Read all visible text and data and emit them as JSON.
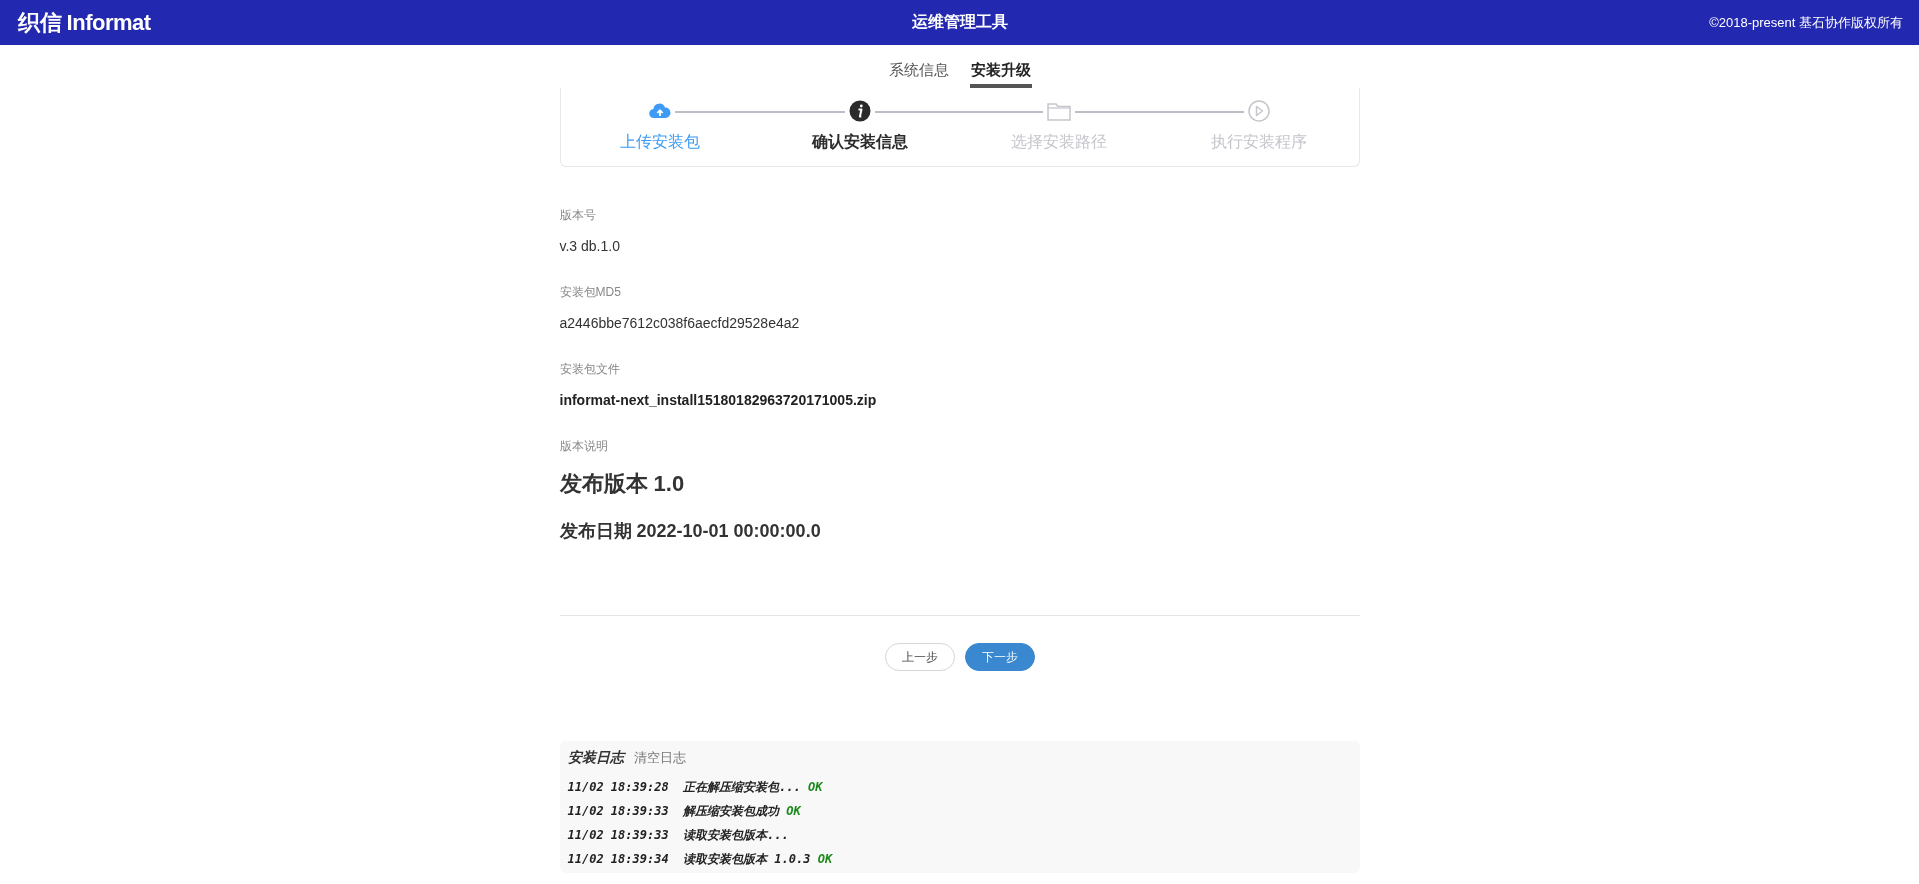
{
  "header": {
    "logo": "织信 Informat",
    "title": "运维管理工具",
    "copyright": "©2018-present 基石协作版权所有"
  },
  "tabs": [
    {
      "label": "系统信息",
      "selected": false
    },
    {
      "label": "安装升级",
      "selected": true
    }
  ],
  "steps": [
    {
      "label": "上传安装包",
      "completed": true,
      "selected": false
    },
    {
      "label": "确认安装信息",
      "completed": false,
      "selected": true
    },
    {
      "label": "选择安装路径",
      "completed": false,
      "selected": false
    },
    {
      "label": "执行安装程序",
      "completed": false,
      "selected": false
    }
  ],
  "fields": [
    {
      "label": "版本号",
      "value": "v.3 db.1.0",
      "kind": "plain"
    },
    {
      "label": "安装包MD5",
      "value": "a2446bbe7612c038f6aecfd29528e4a2",
      "kind": "plain"
    },
    {
      "label": "安装包文件",
      "value": "informat-next_install15180182963720171005.zip",
      "kind": "bold"
    },
    {
      "label": "版本说明",
      "kind": "notes",
      "heading": "发布版本 1.0",
      "subheading": "发布日期 2022-10-01 00:00:00.0"
    }
  ],
  "buttons": [
    {
      "label": "上一步",
      "kind": "secondary"
    },
    {
      "label": "下一步",
      "kind": "primary"
    }
  ],
  "log": {
    "title": "安装日志",
    "clear": "清空日志",
    "entries": [
      {
        "time": "11/02 18:39:28",
        "message": "正在解压缩安装包...",
        "result": "OK"
      },
      {
        "time": "11/02 18:39:33",
        "message": "解压缩安装包成功",
        "result": "OK"
      },
      {
        "time": "11/02 18:39:33",
        "message": "读取安装包版本..."
      },
      {
        "time": "11/02 18:39:34",
        "message": "读取安装包版本 1.0.3",
        "result": "OK"
      }
    ]
  }
}
